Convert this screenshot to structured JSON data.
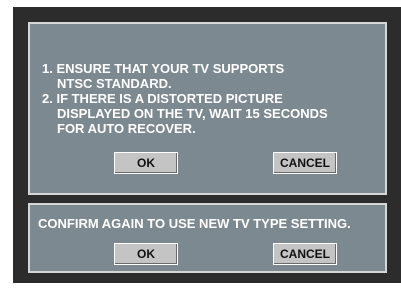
{
  "dialog": {
    "notes": [
      "1. ENSURE THAT YOUR TV SUPPORTS",
      "NTSC STANDARD.",
      "2. IF THERE IS A DISTORTED PICTURE",
      "DISPLAYED ON THE TV, WAIT 15 SECONDS",
      "FOR AUTO RECOVER."
    ],
    "ok_label": "OK",
    "cancel_label": "CANCEL"
  },
  "confirm": {
    "message": "CONFIRM AGAIN TO USE NEW TV TYPE SETTING.",
    "ok_label": "OK",
    "cancel_label": "CANCEL"
  }
}
